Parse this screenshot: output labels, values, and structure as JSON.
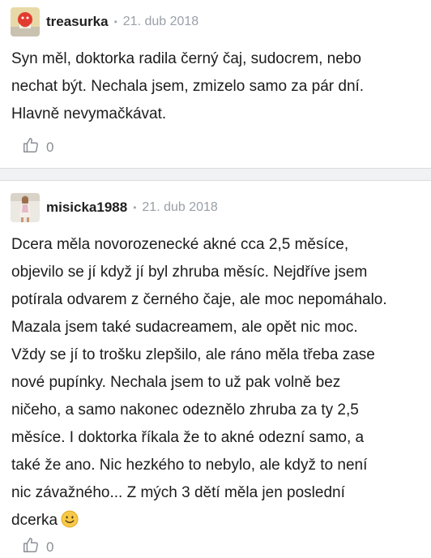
{
  "comments": [
    {
      "username": "treasurka",
      "date": "21. dub 2018",
      "text": "Syn měl, doktorka radila černý čaj, sudocrem, nebo\nnechat být. Nechala jsem, zmizelo samo za pár dní.\nHlavně nevymačkávat.",
      "likes": "0"
    },
    {
      "username": "misicka1988",
      "date": "21. dub 2018",
      "text": "Dcera měla novorozenecké akné cca 2,5 měsíce,\nobjevilo se jí když jí byl zhruba měsíc. Nejdříve jsem\npotírala odvarem z černého čaje, ale moc nepomáhalo.\nMazala jsem také sudacreamem, ale opět nic moc.\nVždy se jí to trošku zlepšilo, ale ráno měla třeba zase\nnové pupínky. Nechala jsem to už pak volně bez\nničeho, a samo nakonec odeznělo zhruba za ty 2,5\nměsíce. I doktorka říkala že to akné odezní samo, a\ntaké že ano. Nic hezkého to nebylo, ale když to není\nnic závažného... Z mých 3 dětí měla jen poslední\ndcerka",
      "emoji": "smiling-face-emoji",
      "likes": "0"
    }
  ],
  "separator": "•",
  "colors": {
    "background": "#f1f2f4",
    "card": "#ffffff",
    "muted": "#9aa0a8",
    "icon": "#8a8f96",
    "emoji": "#f7c948"
  }
}
